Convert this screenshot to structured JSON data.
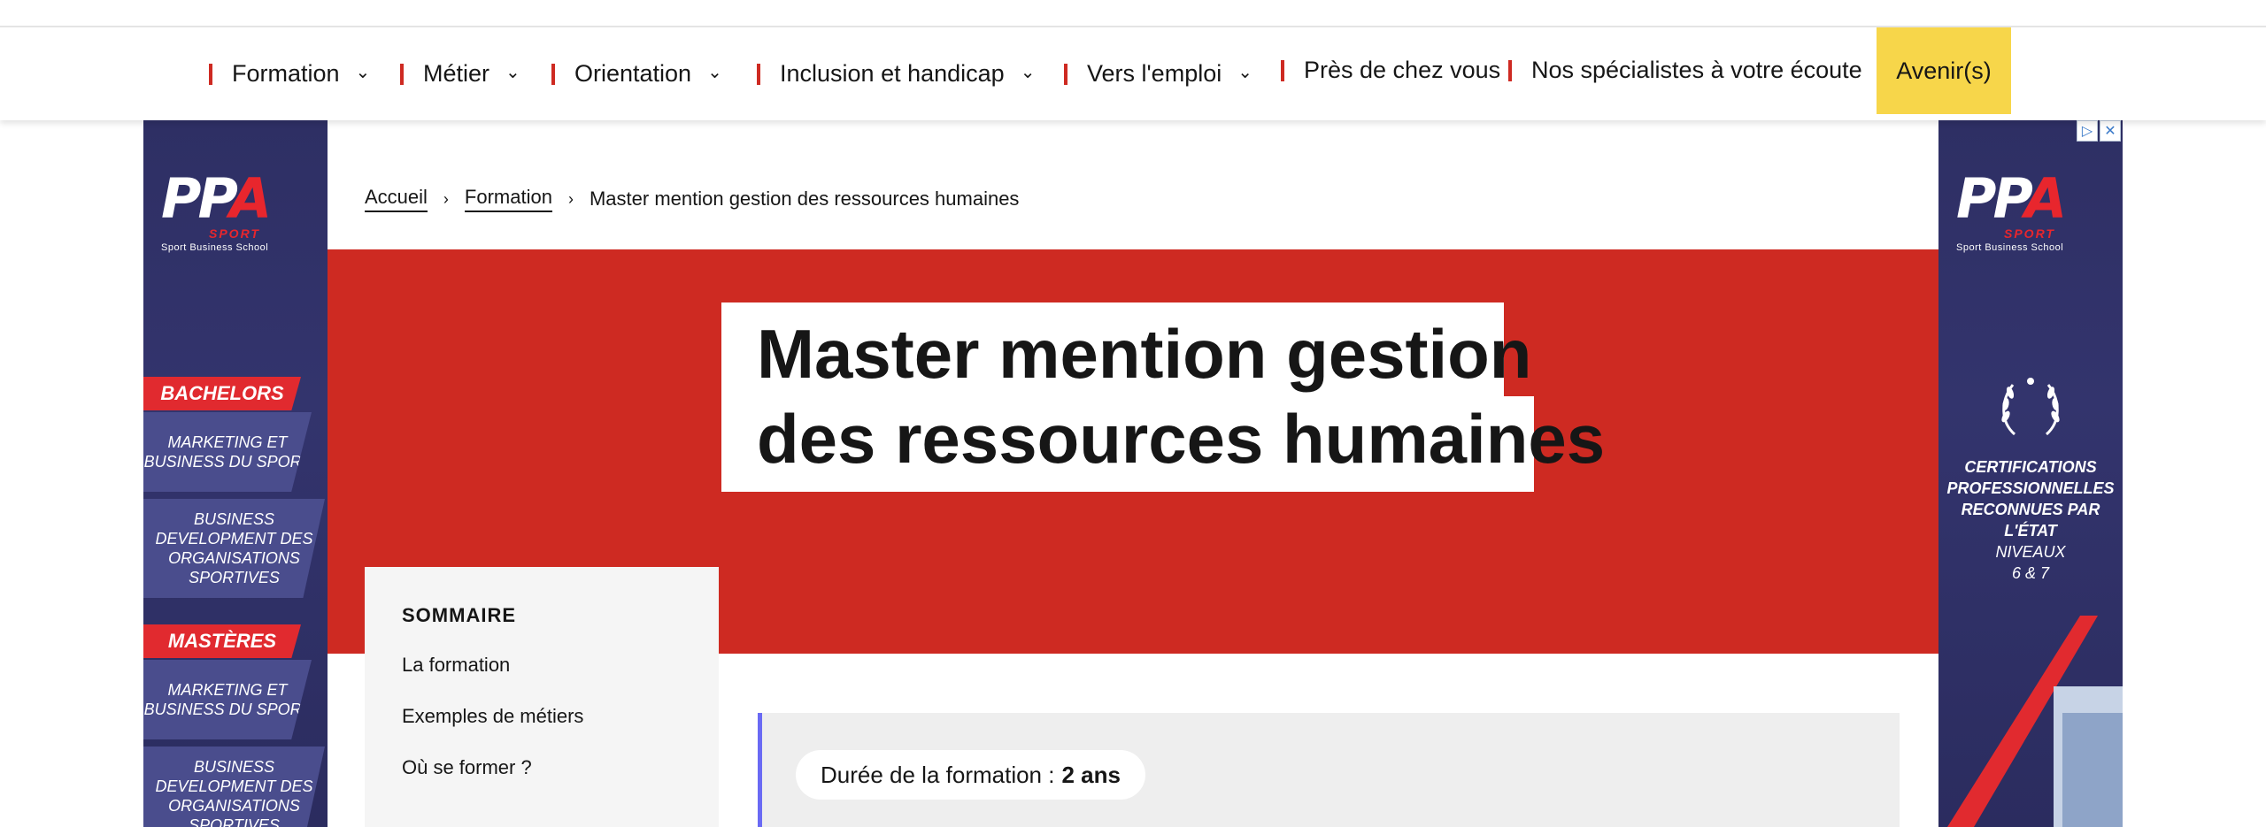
{
  "nav": {
    "items": [
      {
        "label": "Formation",
        "has_dropdown": true
      },
      {
        "label": "Métier",
        "has_dropdown": true
      },
      {
        "label": "Orientation",
        "has_dropdown": true
      },
      {
        "label": "Inclusion et handicap",
        "has_dropdown": true
      },
      {
        "label": "Vers l'emploi",
        "has_dropdown": true
      },
      {
        "label": "Près de chez vous",
        "has_dropdown": false
      },
      {
        "label": "Nos spécialistes à votre écoute",
        "has_dropdown": false
      }
    ],
    "cta": "Avenir(s)",
    "accent_color": "#ce2a22",
    "cta_color": "#f7d64a"
  },
  "breadcrumb": {
    "items": [
      "Accueil",
      "Formation"
    ],
    "current": "Master mention gestion des ressources humaines"
  },
  "hero": {
    "title_line1": "Master mention gestion",
    "title_line2": "des ressources humaines",
    "background_color": "#ce2a22"
  },
  "sommaire": {
    "title": "SOMMAIRE",
    "items": [
      "La formation",
      "Exemples de métiers",
      "Où se former ?"
    ]
  },
  "info": {
    "duration_label": "Durée de la formation :",
    "duration_value": "2 ans"
  },
  "ad_left": {
    "logo_letters": "PPA",
    "logo_sport": "SPORT",
    "logo_tagline": "Sport Business School",
    "section1": "BACHELORS",
    "section1_items": [
      "MARKETING ET BUSINESS DU SPORT",
      "BUSINESS DEVELOPMENT DES ORGANISATIONS SPORTIVES"
    ],
    "section2": "MASTÈRES",
    "section2_items": [
      "MARKETING ET BUSINESS DU SPORT",
      "BUSINESS DEVELOPMENT DES ORGANISATIONS SPORTIVES"
    ]
  },
  "ad_right": {
    "logo_letters": "PPA",
    "logo_sport": "SPORT",
    "logo_tagline": "Sport Business School",
    "cert_bold": "CERTIFICATIONS PROFESSIONNELLES RECONNUES PAR L'ÉTAT",
    "cert_levels_label": "NIVEAUX",
    "cert_levels": "6 & 7",
    "adchoices_icon": "adchoices-icon",
    "close_icon": "close-icon"
  }
}
